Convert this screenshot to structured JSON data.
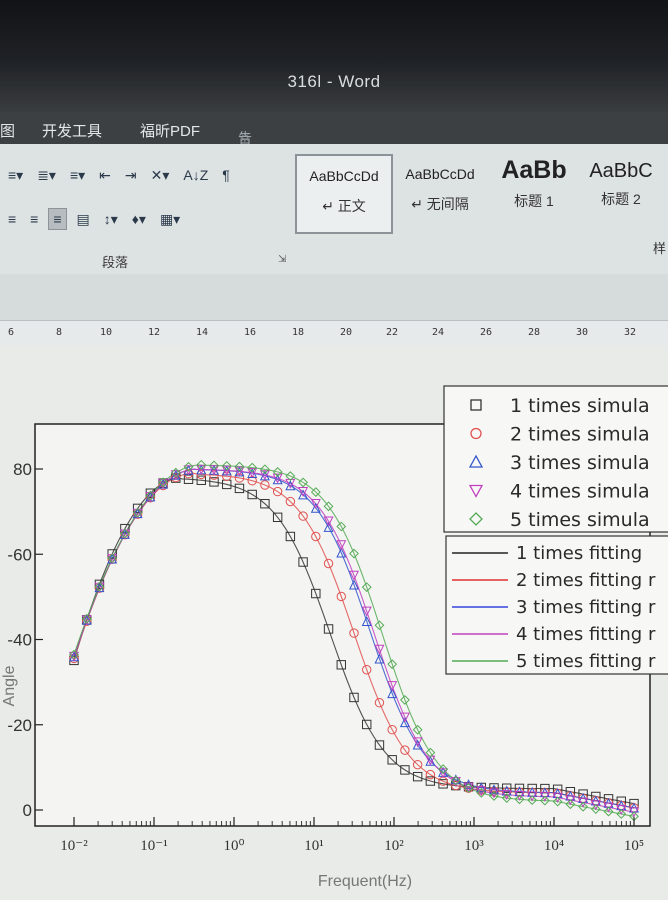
{
  "window": {
    "title": "316l - Word"
  },
  "menu": {
    "partial_left": "图",
    "items": [
      "开发工具",
      "福昕PDF"
    ],
    "tell_me": "告诉我您想要做什么..."
  },
  "ribbon": {
    "paragraph_group_label": "段落",
    "styles_group_label_partial": "样",
    "sort_label": "A↓Z",
    "styles": [
      {
        "sample": "AaBbCcDd",
        "name": "↵ 正文",
        "selected": true
      },
      {
        "sample": "AaBbCcDd",
        "name": "↵ 无间隔",
        "selected": false
      },
      {
        "sample": "AaBb",
        "name": "标题 1",
        "selected": false
      },
      {
        "sample": "AaBbC",
        "name": "标题 2",
        "selected": false
      }
    ]
  },
  "ruler": {
    "labels": [
      "6",
      "8",
      "10",
      "12",
      "14",
      "16",
      "18",
      "20",
      "22",
      "24",
      "26",
      "28",
      "30",
      "32"
    ]
  },
  "chart_data": {
    "type": "scatter",
    "xlabel": "Frequent(Hz)",
    "ylabel": "Angle",
    "x_scale": "log",
    "xlim": [
      0.01,
      100000
    ],
    "ylim": [
      -5,
      -90
    ],
    "x_tick_labels": [
      "10⁻²",
      "10⁻¹",
      "10⁰",
      "10¹",
      "10²",
      "10³",
      "10⁴",
      "10⁵"
    ],
    "y_ticks": [
      0,
      -20,
      -40,
      -60,
      -80
    ],
    "y_tick_labels": [
      "0",
      "-20",
      "-40",
      "-60",
      "80"
    ],
    "legend_markers": [
      {
        "label": "1 times simula",
        "marker": "square",
        "color": "#333333"
      },
      {
        "label": "2 times simula",
        "marker": "circle",
        "color": "#e05050"
      },
      {
        "label": "3 times simula",
        "marker": "triangle-up",
        "color": "#3355cc"
      },
      {
        "label": "4 times simula",
        "marker": "triangle-down",
        "color": "#c040c0"
      },
      {
        "label": "5 times simula",
        "marker": "diamond",
        "color": "#55aa55"
      }
    ],
    "legend_lines": [
      {
        "label": "1 times fitting",
        "color": "#222222"
      },
      {
        "label": "2 times fitting r",
        "color": "#e03030"
      },
      {
        "label": "3 times fitting r",
        "color": "#3344dd"
      },
      {
        "label": "4 times fitting r",
        "color": "#c040c0"
      },
      {
        "label": "5 times fitting r",
        "color": "#55aa55"
      }
    ],
    "series": [
      {
        "name": "1 times simula",
        "color": "#333333",
        "marker": "square",
        "peak_log_f": -0.65,
        "peak_angle": -78,
        "mid_log_f": 1.2,
        "tail_angle": -5
      },
      {
        "name": "2 times simula",
        "color": "#e05050",
        "marker": "circle",
        "peak_log_f": -0.5,
        "peak_angle": -79,
        "mid_log_f": 1.5,
        "tail_angle": -4
      },
      {
        "name": "3 times simula",
        "color": "#3355cc",
        "marker": "triangle-up",
        "peak_log_f": -0.45,
        "peak_angle": -80,
        "mid_log_f": 1.7,
        "tail_angle": -4
      },
      {
        "name": "4 times simula",
        "color": "#c040c0",
        "marker": "triangle-down",
        "peak_log_f": -0.45,
        "peak_angle": -80,
        "mid_log_f": 1.75,
        "tail_angle": -3
      },
      {
        "name": "5 times simula",
        "color": "#55aa55",
        "marker": "diamond",
        "peak_log_f": -0.4,
        "peak_angle": -81,
        "mid_log_f": 1.85,
        "tail_angle": -2
      }
    ]
  }
}
